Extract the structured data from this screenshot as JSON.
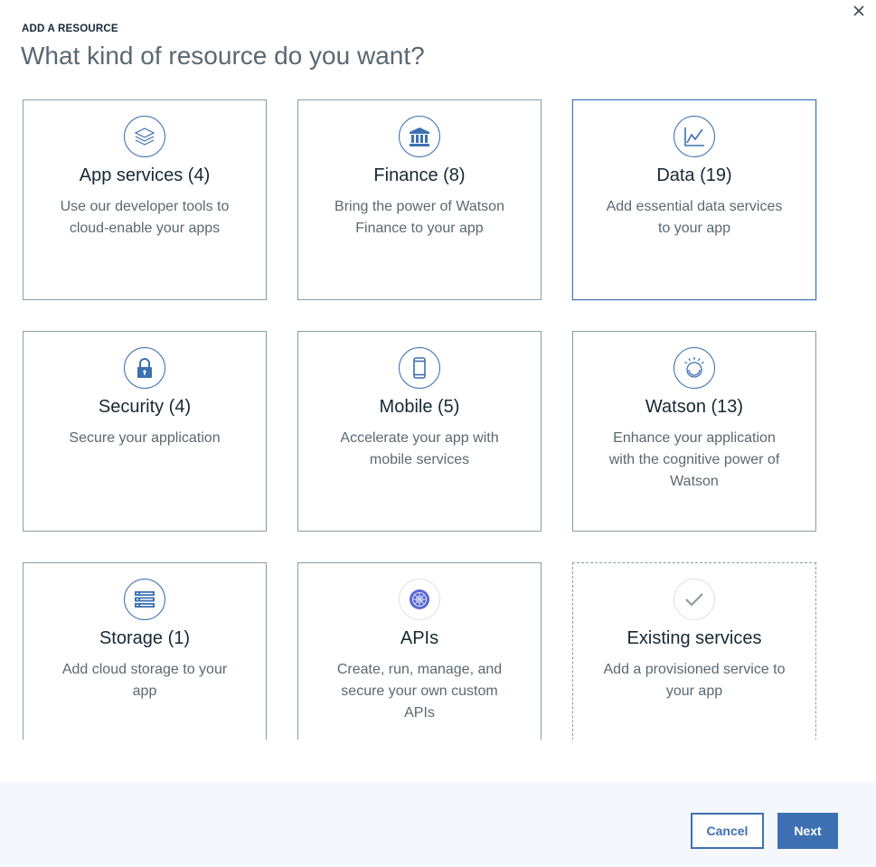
{
  "header": {
    "eyebrow": "ADD A RESOURCE",
    "title": "What kind of resource do you want?",
    "close_icon": "close-icon"
  },
  "colors": {
    "accent": "#3d70b2",
    "border": "#8c9ba5",
    "footer_bg": "#f4f7fb"
  },
  "cards": [
    {
      "title": "App services (4)",
      "desc": "Use our developer tools to cloud-enable your apps",
      "icon": "layers-icon"
    },
    {
      "title": "Finance (8)",
      "desc": "Bring the power of Watson Finance to your app",
      "icon": "bank-icon"
    },
    {
      "title": "Data (19)",
      "desc": "Add essential data services to your app",
      "icon": "line-chart-icon",
      "selected": true
    },
    {
      "title": "Security (4)",
      "desc": "Secure your application",
      "icon": "lock-icon"
    },
    {
      "title": "Mobile (5)",
      "desc": "Accelerate your app with mobile services",
      "icon": "mobile-phone-icon"
    },
    {
      "title": "Watson (13)",
      "desc": "Enhance your application with the cognitive power of Watson",
      "icon": "watson-icon"
    },
    {
      "title": "Storage (1)",
      "desc": "Add cloud storage to your app",
      "icon": "storage-icon"
    },
    {
      "title": "APIs",
      "desc": "Create, run, manage, and secure your own custom APIs",
      "icon": "api-globe-icon"
    },
    {
      "title": "Existing services",
      "desc": "Add a provisioned service to your app",
      "icon": "checkmark-icon"
    }
  ],
  "footer": {
    "cancel_label": "Cancel",
    "next_label": "Next"
  }
}
